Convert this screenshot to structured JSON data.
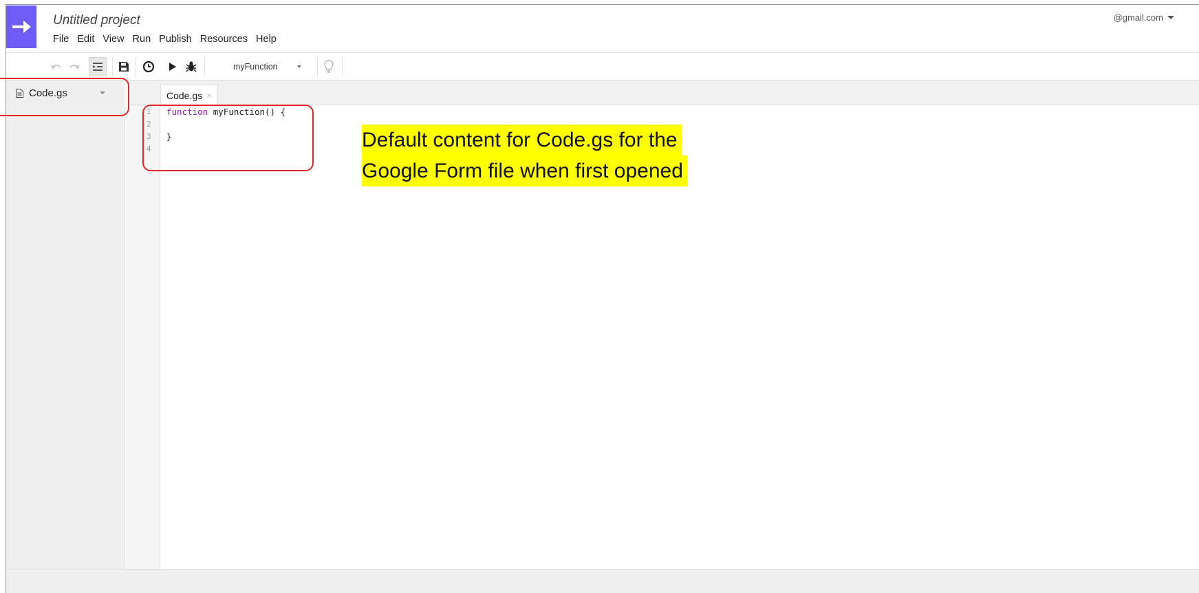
{
  "header": {
    "title": "Untitled project",
    "account": "@gmail.com"
  },
  "menu": [
    "File",
    "Edit",
    "View",
    "Run",
    "Publish",
    "Resources",
    "Help"
  ],
  "toolbar": {
    "function_select": "myFunction"
  },
  "sidebar": {
    "file": "Code.gs"
  },
  "tab": {
    "label": "Code.gs",
    "close": "×"
  },
  "editor": {
    "line_numbers": [
      "1",
      "2",
      "3",
      "4"
    ],
    "keyword": "function",
    "line1_rest": " myFunction() {",
    "line2": "",
    "line3": "}",
    "line4": ""
  },
  "annotation": {
    "line1": "Default content for Code.gs for the",
    "line2": "Google Form file when first opened"
  },
  "colors": {
    "logo": "#6f5cf5",
    "keyword": "#8b1fa8",
    "highlight": "#ffff00",
    "callout": "#e52424"
  }
}
